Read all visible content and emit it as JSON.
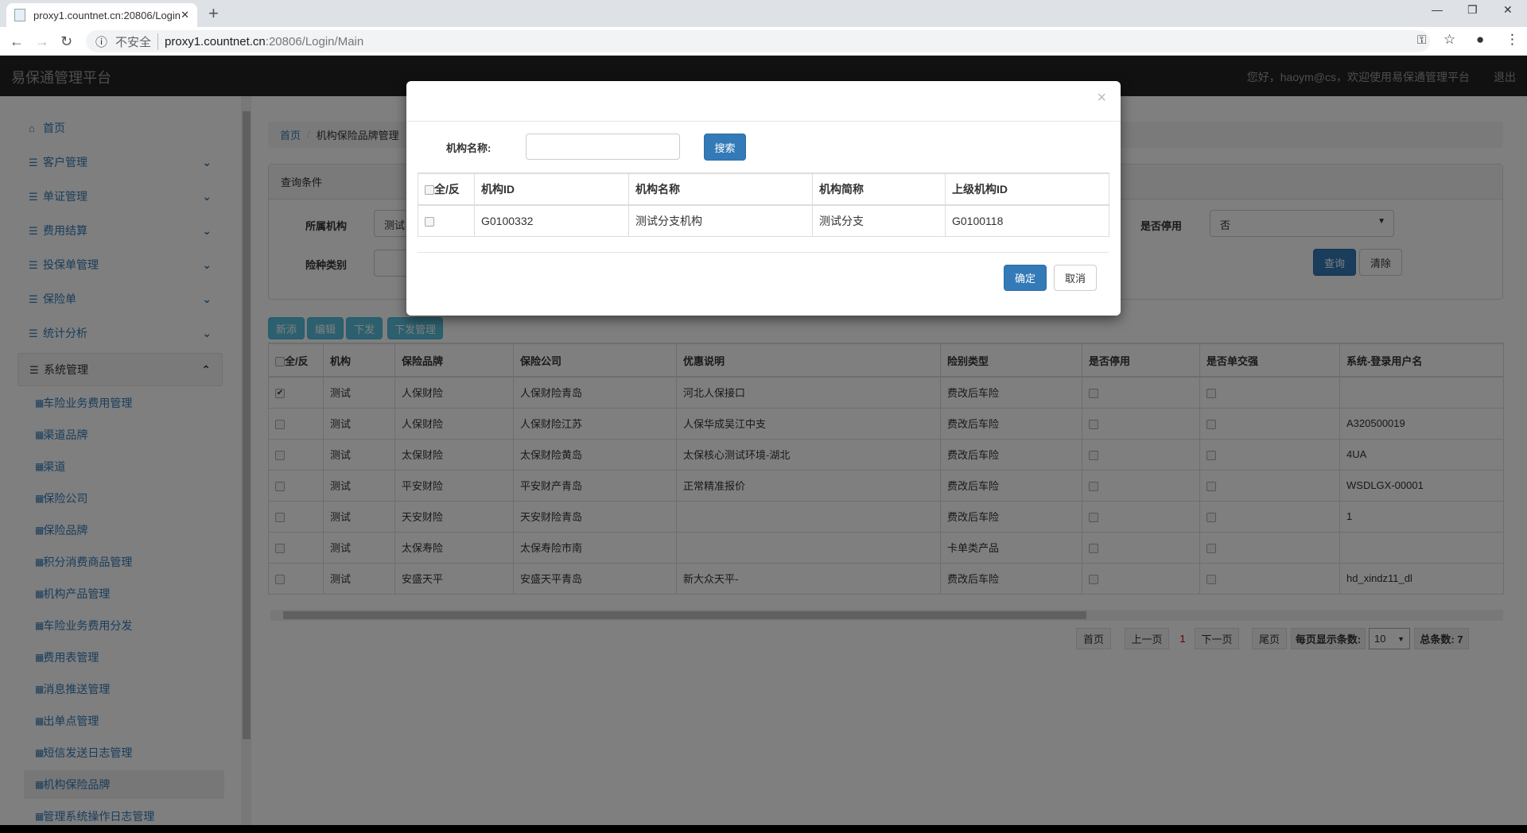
{
  "browser": {
    "tab_title": "proxy1.countnet.cn:20806/Login/Main",
    "new_tab": "+",
    "insecure_label": "不安全",
    "url_host": "proxy1.countnet.cn",
    "url_path": ":20806/Login/Main"
  },
  "header": {
    "brand": "易保通管理平台",
    "welcome": "您好，haoym@cs，欢迎使用易保通管理平台",
    "logout": "退出"
  },
  "sidebar": {
    "items": [
      {
        "label": "首页",
        "icon": "home-icon"
      },
      {
        "label": "客户管理",
        "icon": "list-icon"
      },
      {
        "label": "单证管理",
        "icon": "list-icon"
      },
      {
        "label": "费用结算",
        "icon": "list-icon"
      },
      {
        "label": "投保单管理",
        "icon": "list-icon"
      },
      {
        "label": "保险单",
        "icon": "list-icon"
      },
      {
        "label": "统计分析",
        "icon": "list-icon"
      },
      {
        "label": "系统管理",
        "icon": "list-icon",
        "expanded": true
      }
    ],
    "subitems": [
      "车险业务费用管理",
      "渠道品牌",
      "渠道",
      "保险公司",
      "保险品牌",
      "积分消费商品管理",
      "机构产品管理",
      "车险业务费用分发",
      "费用表管理",
      "消息推送管理",
      "出单点管理",
      "短信发送日志管理",
      "机构保险品牌",
      "管理系统操作日志管理"
    ],
    "active_subitem": "机构保险品牌"
  },
  "breadcrumb": {
    "home": "首页",
    "current": "机构保险品牌管理"
  },
  "query": {
    "title": "查询条件",
    "org_label": "所属机构",
    "org_value": "测试",
    "type_label": "险种类别",
    "disabled_label": "是否停用",
    "disabled_value": "否",
    "search_btn": "查询",
    "clear_btn": "清除"
  },
  "toolbar": {
    "add": "新添",
    "edit": "编辑",
    "dispatch": "下发",
    "dispatch_manage": "下发管理"
  },
  "table": {
    "columns": [
      "全/反",
      "机构",
      "保险品牌",
      "保险公司",
      "优惠说明",
      "险别类型",
      "是否停用",
      "是否单交强",
      "系统-登录用户名"
    ],
    "rows": [
      {
        "checked": true,
        "org": "测试",
        "brand": "人保财险",
        "company": "人保财险青岛",
        "promo": "河北人保接口",
        "type": "费改后车险",
        "user": ""
      },
      {
        "checked": false,
        "org": "测试",
        "brand": "人保财险",
        "company": "人保财险江苏",
        "promo": "人保华成吴江中支",
        "type": "费改后车险",
        "user": "A320500019"
      },
      {
        "checked": false,
        "org": "测试",
        "brand": "太保财险",
        "company": "太保财险黄岛",
        "promo": "太保核心测试环境-湖北",
        "type": "费改后车险",
        "user": "4UA"
      },
      {
        "checked": false,
        "org": "测试",
        "brand": "平安财险",
        "company": "平安财产青岛",
        "promo": "正常精准报价",
        "type": "费改后车险",
        "user": "WSDLGX-00001"
      },
      {
        "checked": false,
        "org": "测试",
        "brand": "天安财险",
        "company": "天安财险青岛",
        "promo": "",
        "type": "费改后车险",
        "user": "1"
      },
      {
        "checked": false,
        "org": "测试",
        "brand": "太保寿险",
        "company": "太保寿险市南",
        "promo": "",
        "type": "卡单类产品",
        "user": ""
      },
      {
        "checked": false,
        "org": "测试",
        "brand": "安盛天平",
        "company": "安盛天平青岛",
        "promo": "新大众天平-",
        "type": "费改后车险",
        "user": "hd_xindz11_dl"
      }
    ]
  },
  "pagination": {
    "first": "首页",
    "prev": "上一页",
    "current": "1",
    "next": "下一页",
    "last": "尾页",
    "page_size_label": "每页显示条数:",
    "page_size": "10",
    "total": "总条数: 7"
  },
  "modal": {
    "close": "×",
    "name_label": "机构名称:",
    "name_value": "",
    "search": "搜索",
    "columns": [
      "全/反",
      "机构ID",
      "机构名称",
      "机构简称",
      "上级机构ID"
    ],
    "rows": [
      {
        "id": "G0100332",
        "name": "测试分支机构",
        "short": "测试分支",
        "parent": "G0100118"
      }
    ],
    "ok": "确定",
    "cancel": "取消"
  }
}
